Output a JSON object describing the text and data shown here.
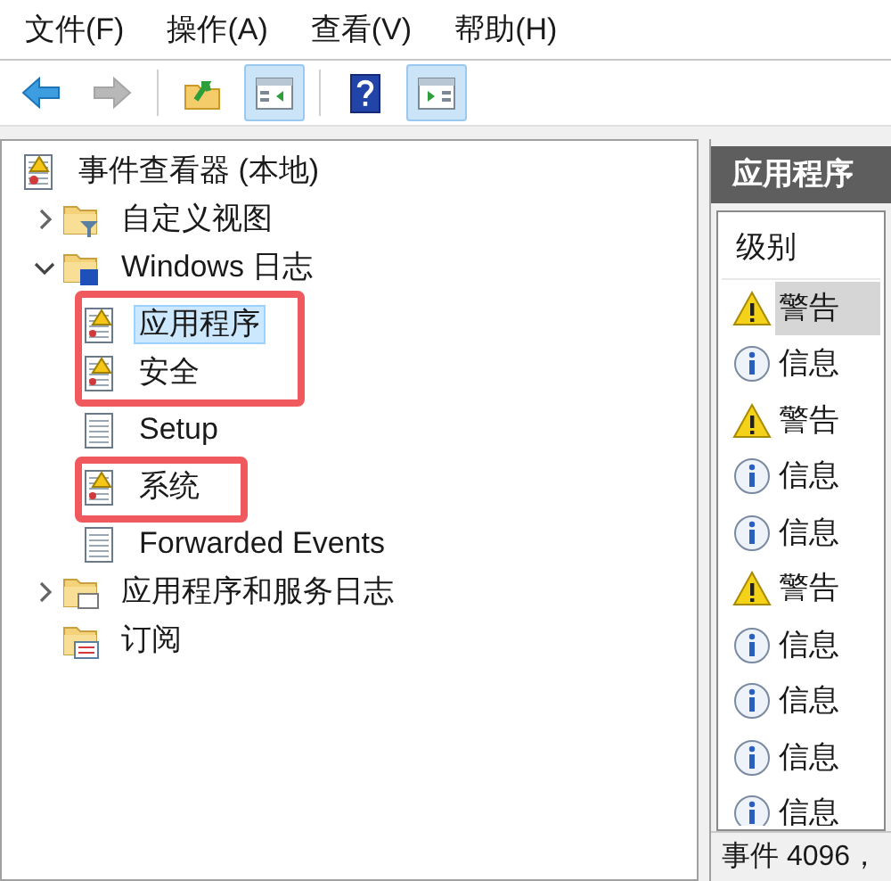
{
  "menu": [
    {
      "label": "文件(F)"
    },
    {
      "label": "操作(A)"
    },
    {
      "label": "查看(V)"
    },
    {
      "label": "帮助(H)"
    }
  ],
  "toolbar": [
    {
      "kind": "back",
      "disabled": false,
      "pressed": false
    },
    {
      "kind": "forward",
      "disabled": true,
      "pressed": false
    },
    {
      "kind": "separator"
    },
    {
      "kind": "up",
      "disabled": false,
      "pressed": false
    },
    {
      "kind": "tree-pane",
      "disabled": false,
      "pressed": true
    },
    {
      "kind": "separator"
    },
    {
      "kind": "help",
      "disabled": false,
      "pressed": false
    },
    {
      "kind": "action-pane",
      "disabled": false,
      "pressed": true
    }
  ],
  "tree": [
    {
      "label": "事件查看器 (本地)",
      "kind": "root",
      "selected": false,
      "children": [
        {
          "label": "自定义视图",
          "kind": "filter-folder",
          "expanded": false,
          "selected": false
        },
        {
          "label": "Windows 日志",
          "kind": "windows-folder",
          "expanded": true,
          "selected": false,
          "children": [
            {
              "label": "应用程序",
              "kind": "log",
              "selected": true,
              "marked": true
            },
            {
              "label": "安全",
              "kind": "log",
              "selected": false,
              "marked": true
            },
            {
              "label": "Setup",
              "kind": "plain-log",
              "selected": false,
              "marked": false
            },
            {
              "label": "系统",
              "kind": "log",
              "selected": false,
              "marked": true
            },
            {
              "label": "Forwarded Events",
              "kind": "plain-log",
              "selected": false,
              "marked": false
            }
          ]
        },
        {
          "label": "应用程序和服务日志",
          "kind": "folder",
          "expanded": false,
          "selected": false
        },
        {
          "label": "订阅",
          "kind": "subscription-folder",
          "selected": false
        }
      ]
    }
  ],
  "panel": {
    "title": "应用程序",
    "column": "级别",
    "rows": [
      {
        "kind": "warning",
        "text": "警告",
        "selected": true
      },
      {
        "kind": "info",
        "text": "信息",
        "selected": false
      },
      {
        "kind": "warning",
        "text": "警告",
        "selected": false
      },
      {
        "kind": "info",
        "text": "信息",
        "selected": false
      },
      {
        "kind": "info",
        "text": "信息",
        "selected": false
      },
      {
        "kind": "warning",
        "text": "警告",
        "selected": false
      },
      {
        "kind": "info",
        "text": "信息",
        "selected": false
      },
      {
        "kind": "info",
        "text": "信息",
        "selected": false
      },
      {
        "kind": "info",
        "text": "信息",
        "selected": false
      },
      {
        "kind": "info",
        "text": "信息",
        "selected": false
      }
    ],
    "status": "事件 4096，"
  }
}
